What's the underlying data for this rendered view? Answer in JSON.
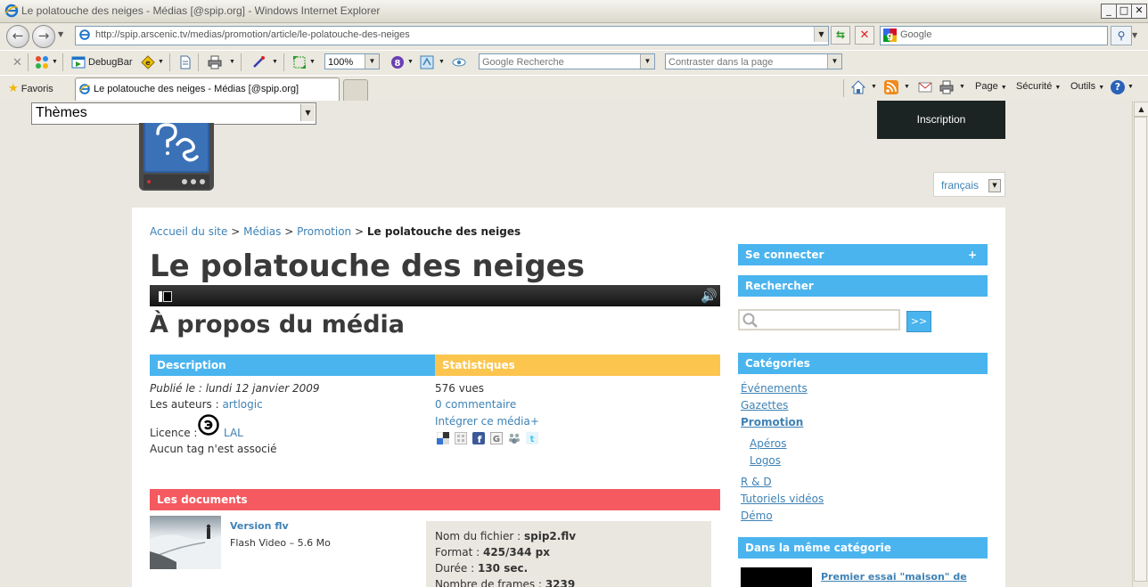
{
  "window": {
    "title": "Le polatouche des neiges - Médias [@spip.org] - Windows Internet Explorer"
  },
  "address_bar": {
    "url": "http://spip.arscenic.tv/medias/promotion/article/le-polatouche-des-neiges",
    "search_placeholder": "Google"
  },
  "toolbar": {
    "debugbar_label": "DebugBar",
    "zoom_value": "100%",
    "google_search_placeholder": "Google Recherche",
    "contrast_placeholder": "Contraster dans la page"
  },
  "tabs_row": {
    "favorites_label": "Favoris",
    "active_tab_title": "Le polatouche des neiges - Médias [@spip.org]",
    "page_menu": "Page",
    "security_menu": "Sécurité",
    "tools_menu": "Outils"
  },
  "page": {
    "themes_select": "Thèmes",
    "inscription_label": "Inscription",
    "language_select": "français",
    "breadcrumb": {
      "home": "Accueil du site",
      "sep": ">",
      "medias": "Médias",
      "promotion": "Promotion",
      "current": "Le polatouche des neiges"
    },
    "title": "Le polatouche des neiges",
    "about_heading": "À propos du média",
    "description": {
      "heading": "Description",
      "published": "Publié le : lundi 12 janvier 2009",
      "authors_label": "Les auteurs :",
      "author": "artlogic",
      "licence_label": "Licence :",
      "licence_value": "LAL",
      "tags": "Aucun tag n'est associé"
    },
    "stats": {
      "heading": "Statistiques",
      "views": "576 vues",
      "comments": "0 commentaire",
      "embed": "Intégrer ce média+"
    },
    "documents": {
      "heading": "Les documents",
      "doc_title": "Version flv",
      "doc_subtitle": "Flash Video – 5.6 Mo",
      "filename_label": "Nom du fichier :",
      "filename_value": "spip2.flv",
      "format_label": "Format :",
      "format_value": "425/344 px",
      "duration_label": "Durée :",
      "duration_value": "130 sec.",
      "frames_label": "Nombre de frames :",
      "frames_value": "3239"
    },
    "sidebar": {
      "login": "Se connecter",
      "login_plus": "+",
      "search": "Rechercher",
      "search_button": ">>",
      "categories_heading": "Catégories",
      "categories": [
        "Événements",
        "Gazettes",
        "Promotion",
        "Apéros",
        "Logos",
        "R & D",
        "Tutoriels vidéos",
        "Démo"
      ],
      "same_category_heading": "Dans la même catégorie",
      "related_title": "Premier essai \"maison\" de"
    }
  },
  "colors": {
    "blue_heading": "#4ab4ef",
    "yellow_heading": "#fcc54e",
    "red_heading": "#f45a5f",
    "link": "#3e82b5",
    "dark_button": "#1b2323"
  }
}
